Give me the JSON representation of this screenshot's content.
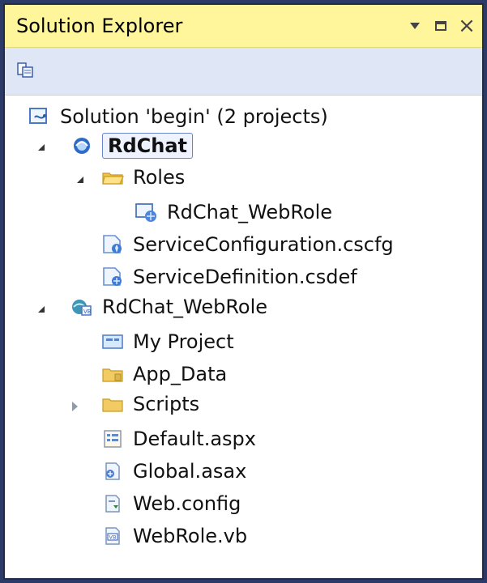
{
  "window": {
    "title": "Solution Explorer",
    "close_glyph": "×"
  },
  "toolbar": {
    "properties_icon": "properties-icon"
  },
  "tree": {
    "solution": {
      "label": "Solution 'begin' (2 projects)",
      "icon": "solution-icon"
    },
    "project1": {
      "label": "RdChat",
      "icon": "cloud-project-icon"
    },
    "roles_folder": {
      "label": "Roles",
      "icon": "folder-open-icon"
    },
    "role_item": {
      "label": "RdChat_WebRole",
      "icon": "web-role-icon"
    },
    "service_config": {
      "label": "ServiceConfiguration.cscfg",
      "icon": "service-config-icon"
    },
    "service_def": {
      "label": "ServiceDefinition.csdef",
      "icon": "service-definition-icon"
    },
    "project2": {
      "label": "RdChat_WebRole",
      "icon": "web-project-icon"
    },
    "my_project": {
      "label": "My Project",
      "icon": "my-project-icon"
    },
    "app_data": {
      "label": "App_Data",
      "icon": "app-data-folder-icon"
    },
    "scripts": {
      "label": "Scripts",
      "icon": "folder-icon"
    },
    "default_aspx": {
      "label": "Default.aspx",
      "icon": "aspx-file-icon"
    },
    "global_asax": {
      "label": "Global.asax",
      "icon": "asax-file-icon"
    },
    "web_config": {
      "label": "Web.config",
      "icon": "config-file-icon"
    },
    "webrole_vb": {
      "label": "WebRole.vb",
      "icon": "vb-file-icon"
    }
  },
  "colors": {
    "title_bar": "#fff59a",
    "toolbar": "#dfe6f5",
    "frame": "#1f2c4e",
    "selection_border": "#6a86c9"
  }
}
